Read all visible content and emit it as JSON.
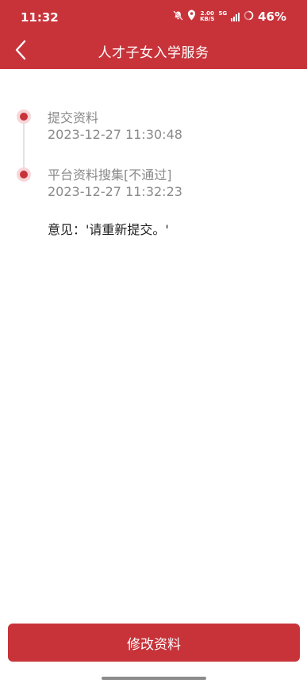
{
  "status_bar": {
    "time": "11:32",
    "network_speed_top": "2.00",
    "network_speed_bottom": "KB/S",
    "network_type": "5G",
    "battery_percent": "46%",
    "icons": [
      "bell-off-icon",
      "location-icon",
      "network-speed-icon",
      "signal-icon",
      "battery-icon"
    ]
  },
  "header": {
    "title": "人才子女入学服务",
    "back_icon": "chevron-left-icon"
  },
  "timeline": {
    "steps": [
      {
        "label": "提交资料",
        "datetime": "2023-12-27 11:30:48"
      },
      {
        "label": "平台资料搜集[不通过]",
        "datetime": "2023-12-27 11:32:23"
      }
    ],
    "opinion": "意见：'请重新提交。'"
  },
  "actions": {
    "edit_label": "修改资料"
  },
  "colors": {
    "brand": "#c8333a",
    "dot_halo": "#f7d6d8",
    "muted_text": "#8a8a8a"
  }
}
